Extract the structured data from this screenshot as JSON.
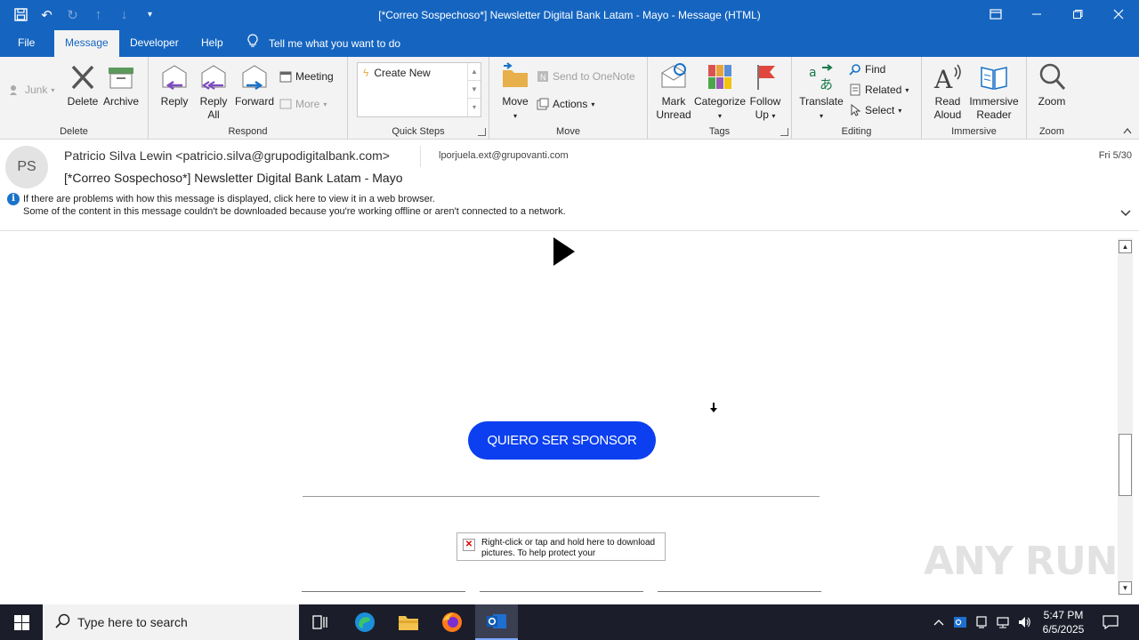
{
  "window": {
    "title": "[*Correo Sospechoso*] Newsletter Digital Bank Latam - Mayo  -  Message (HTML)",
    "accent": "#1565c0"
  },
  "tabs": [
    {
      "label": "File"
    },
    {
      "label": "Message"
    },
    {
      "label": "Developer"
    },
    {
      "label": "Help"
    }
  ],
  "tell_me": "Tell me what you want to do",
  "ribbon": {
    "delete_group": {
      "label": "Delete",
      "junk": "Junk",
      "delete": "Delete",
      "archive": "Archive"
    },
    "respond_group": {
      "label": "Respond",
      "reply": "Reply",
      "reply_all_1": "Reply",
      "reply_all_2": "All",
      "forward": "Forward",
      "meeting": "Meeting",
      "more": "More"
    },
    "quick_steps_group": {
      "label": "Quick Steps",
      "create_new": "Create New"
    },
    "move_group": {
      "label": "Move",
      "move": "Move",
      "send_to_onenote": "Send to OneNote",
      "actions": "Actions"
    },
    "tags_group": {
      "label": "Tags",
      "mark_unread_1": "Mark",
      "mark_unread_2": "Unread",
      "categorize": "Categorize",
      "follow_up_1": "Follow",
      "follow_up_2": "Up"
    },
    "editing_group": {
      "label": "Editing",
      "translate": "Translate",
      "find": "Find",
      "related": "Related",
      "select": "Select"
    },
    "immersive_group": {
      "label": "Immersive",
      "read_aloud_1": "Read",
      "read_aloud_2": "Aloud",
      "immersive_reader_1": "Immersive",
      "immersive_reader_2": "Reader"
    },
    "zoom_group": {
      "label": "Zoom",
      "zoom": "Zoom"
    }
  },
  "message": {
    "avatar_initials": "PS",
    "sender": "Patricio Silva Lewin <patricio.silva@grupodigitalbank.com>",
    "to": "lporjuela.ext@grupovanti.com",
    "date": "Fri 5/30",
    "subject": "[*Correo Sospechoso*] Newsletter Digital Bank Latam - Mayo",
    "info_line_1": "If there are problems with how this message is displayed, click here to view it in a web browser.",
    "info_line_2": "Some of the content in this message couldn't be downloaded because you're working offline or aren't connected to a network."
  },
  "body": {
    "sponsor_button": "QUIERO SER SPONSOR",
    "sponsor_color": "#0b3fef",
    "broken_image_text": "Right-click or tap and hold here to download pictures. To help protect your"
  },
  "watermark": "ANY RUN",
  "taskbar": {
    "search_placeholder": "Type here to search",
    "time": "5:47 PM",
    "date": "6/5/2025"
  }
}
